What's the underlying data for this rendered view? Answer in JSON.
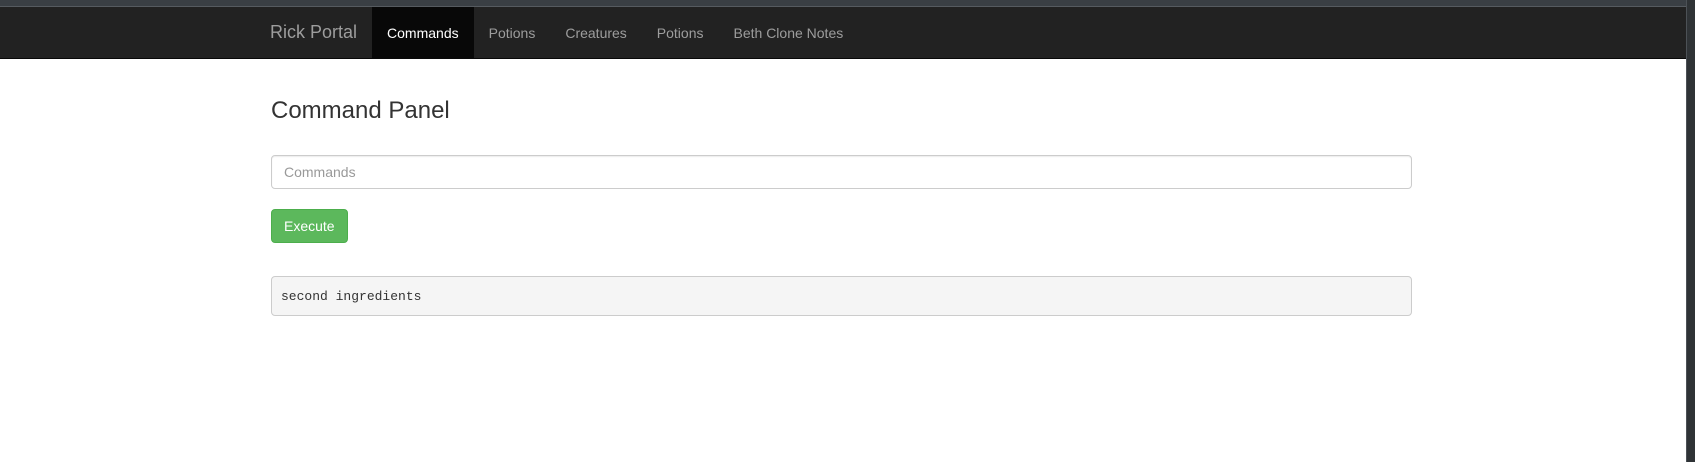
{
  "navbar": {
    "brand": "Rick Portal",
    "items": [
      {
        "label": "Commands",
        "active": true
      },
      {
        "label": "Potions",
        "active": false
      },
      {
        "label": "Creatures",
        "active": false
      },
      {
        "label": "Potions",
        "active": false
      },
      {
        "label": "Beth Clone Notes",
        "active": false
      }
    ]
  },
  "main": {
    "title": "Command Panel",
    "command_input": {
      "value": "",
      "placeholder": "Commands"
    },
    "execute_label": "Execute",
    "output_text": "second ingredients"
  },
  "colors": {
    "navbar_bg": "#222222",
    "active_tab_bg": "#080808",
    "execute_bg": "#5cb85c",
    "output_bg": "#f5f5f5"
  }
}
